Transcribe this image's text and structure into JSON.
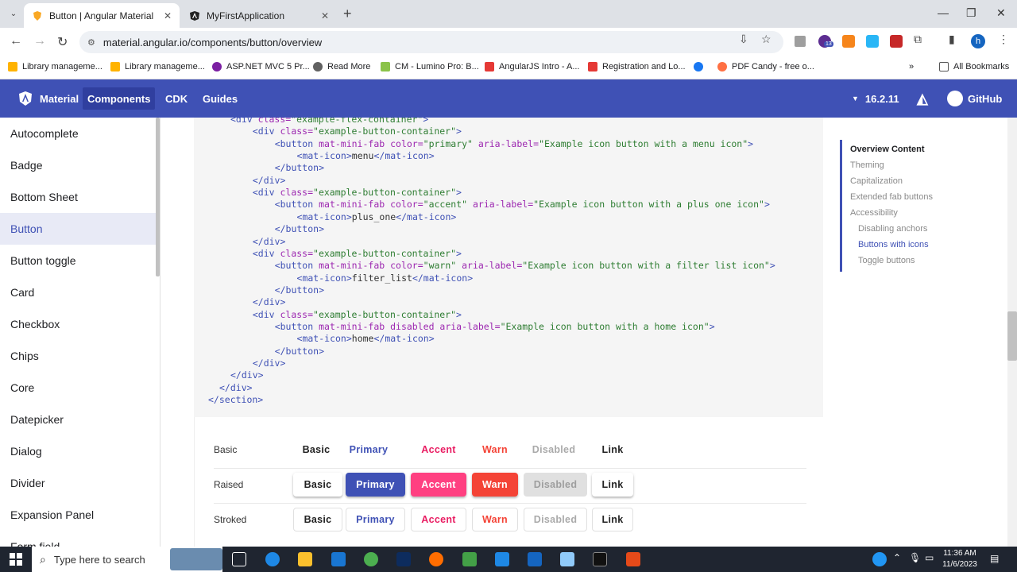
{
  "browser": {
    "tabs": [
      {
        "title": "Button | Angular Material",
        "active": true
      },
      {
        "title": "MyFirstApplication",
        "active": false
      }
    ],
    "url": "material.angular.io/components/button/overview",
    "bookmarks": [
      "Library manageme...",
      "Library manageme...",
      "ASP.NET MVC 5 Pr...",
      "Read More",
      "CM - Lumino Pro: B...",
      "AngularJS Intro - A...",
      "Registration and Lo...",
      "PDF Candy - free o..."
    ],
    "all_bookmarks": "All Bookmarks",
    "profile_initial": "h",
    "ext_badge": "13"
  },
  "header": {
    "brand": "Material",
    "nav": [
      "Components",
      "CDK",
      "Guides"
    ],
    "version": "16.2.11",
    "github": "GitHub"
  },
  "sidenav": {
    "items": [
      "Autocomplete",
      "Badge",
      "Bottom Sheet",
      "Button",
      "Button toggle",
      "Card",
      "Checkbox",
      "Chips",
      "Core",
      "Datepicker",
      "Dialog",
      "Divider",
      "Expansion Panel",
      "Form field"
    ],
    "selected": "Button"
  },
  "code": [
    [
      [
        "tg",
        "<div "
      ],
      [
        "at",
        "class="
      ],
      [
        "st",
        "\"example-flex-container\""
      ],
      [
        "tg",
        ">"
      ]
    ],
    [
      [
        "tg",
        "  <div "
      ],
      [
        "at",
        "class="
      ],
      [
        "st",
        "\"example-button-container\""
      ],
      [
        "tg",
        ">"
      ]
    ],
    [
      [
        "tg",
        "    <button "
      ],
      [
        "at",
        "mat-mini-fab color="
      ],
      [
        "st",
        "\"primary\""
      ],
      [
        "at",
        " aria-label="
      ],
      [
        "st",
        "\"Example icon button with a menu icon\""
      ],
      [
        "tg",
        ">"
      ]
    ],
    [
      [
        "tg",
        "      <mat-icon>"
      ],
      [
        "tx",
        "menu"
      ],
      [
        "tg",
        "</mat-icon>"
      ]
    ],
    [
      [
        "tg",
        "    </button>"
      ]
    ],
    [
      [
        "tg",
        "  </div>"
      ]
    ],
    [
      [
        "tg",
        "  <div "
      ],
      [
        "at",
        "class="
      ],
      [
        "st",
        "\"example-button-container\""
      ],
      [
        "tg",
        ">"
      ]
    ],
    [
      [
        "tg",
        "    <button "
      ],
      [
        "at",
        "mat-mini-fab color="
      ],
      [
        "st",
        "\"accent\""
      ],
      [
        "at",
        " aria-label="
      ],
      [
        "st",
        "\"Example icon button with a plus one icon\""
      ],
      [
        "tg",
        ">"
      ]
    ],
    [
      [
        "tg",
        "      <mat-icon>"
      ],
      [
        "tx",
        "plus_one"
      ],
      [
        "tg",
        "</mat-icon>"
      ]
    ],
    [
      [
        "tg",
        "    </button>"
      ]
    ],
    [
      [
        "tg",
        "  </div>"
      ]
    ],
    [
      [
        "tg",
        "  <div "
      ],
      [
        "at",
        "class="
      ],
      [
        "st",
        "\"example-button-container\""
      ],
      [
        "tg",
        ">"
      ]
    ],
    [
      [
        "tg",
        "    <button "
      ],
      [
        "at",
        "mat-mini-fab color="
      ],
      [
        "st",
        "\"warn\""
      ],
      [
        "at",
        " aria-label="
      ],
      [
        "st",
        "\"Example icon button with a filter list icon\""
      ],
      [
        "tg",
        ">"
      ]
    ],
    [
      [
        "tg",
        "      <mat-icon>"
      ],
      [
        "tx",
        "filter_list"
      ],
      [
        "tg",
        "</mat-icon>"
      ]
    ],
    [
      [
        "tg",
        "    </button>"
      ]
    ],
    [
      [
        "tg",
        "  </div>"
      ]
    ],
    [
      [
        "tg",
        "  <div "
      ],
      [
        "at",
        "class="
      ],
      [
        "st",
        "\"example-button-container\""
      ],
      [
        "tg",
        ">"
      ]
    ],
    [
      [
        "tg",
        "    <button "
      ],
      [
        "at",
        "mat-mini-fab disabled aria-label="
      ],
      [
        "st",
        "\"Example icon button with a home icon\""
      ],
      [
        "tg",
        ">"
      ]
    ],
    [
      [
        "tg",
        "      <mat-icon>"
      ],
      [
        "tx",
        "home"
      ],
      [
        "tg",
        "</mat-icon>"
      ]
    ],
    [
      [
        "tg",
        "    </button>"
      ]
    ],
    [
      [
        "tg",
        "  </div>"
      ]
    ],
    [
      [
        "tg",
        "</div>"
      ]
    ],
    [
      [
        "tg",
        "</div>"
      ]
    ],
    [
      [
        "tg",
        "</section>"
      ]
    ]
  ],
  "demo": {
    "rows": [
      {
        "label": "Basic",
        "buttons": [
          "Basic",
          "Primary",
          "Accent",
          "Warn",
          "Disabled",
          "Link"
        ]
      },
      {
        "label": "Raised",
        "buttons": [
          "Basic",
          "Primary",
          "Accent",
          "Warn",
          "Disabled",
          "Link"
        ]
      },
      {
        "label": "Stroked",
        "buttons": [
          "Basic",
          "Primary",
          "Accent",
          "Warn",
          "Disabled",
          "Link"
        ]
      }
    ]
  },
  "toc": {
    "items": [
      "Overview Content",
      "Theming",
      "Capitalization",
      "Extended fab buttons",
      "Accessibility",
      "Disabling anchors",
      "Buttons with icons",
      "Toggle buttons"
    ]
  },
  "taskbar": {
    "search_placeholder": "Type here to search",
    "time": "11:36 AM",
    "date": "11/6/2023"
  },
  "colors": {
    "primary": "#3f51b5",
    "accent": "#ff4081",
    "warn": "#f44336"
  }
}
